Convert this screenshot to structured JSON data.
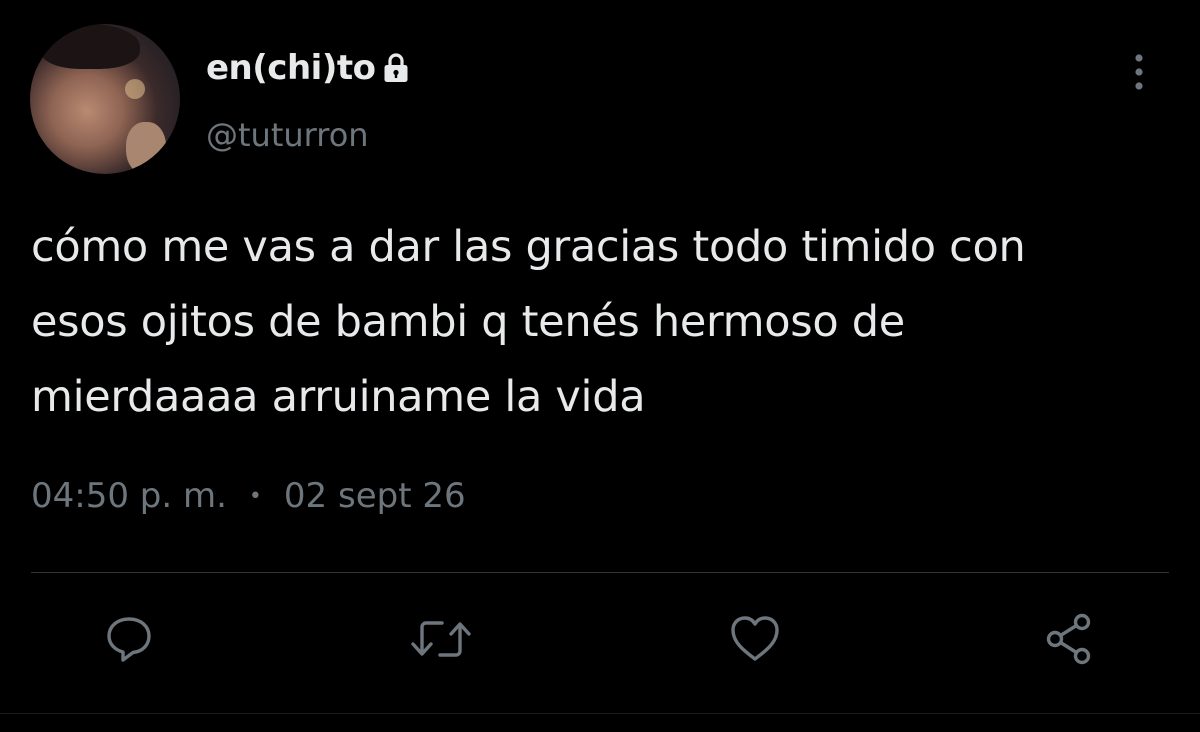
{
  "user": {
    "display_name": "en(chi)to",
    "handle": "@tuturron",
    "protected_icon": "lock-icon",
    "avatar": "profile-photo"
  },
  "tweet": {
    "lines": [
      "cómo me vas a dar las gracias todo timido con",
      "esos ojitos de bambi q tenés hermoso de",
      "mierdaaaa arruiname la vida"
    ],
    "time": "04:50 p. m.",
    "separator": "•",
    "date": "02 sept 26"
  },
  "actions": {
    "reply": "reply-icon",
    "retweet": "retweet-icon",
    "like": "heart-icon",
    "share": "share-icon",
    "more": "more-vertical-icon"
  },
  "colors": {
    "background": "#000000",
    "text": "#e7e9ea",
    "secondary": "#6e767d",
    "divider": "#2f3336"
  }
}
